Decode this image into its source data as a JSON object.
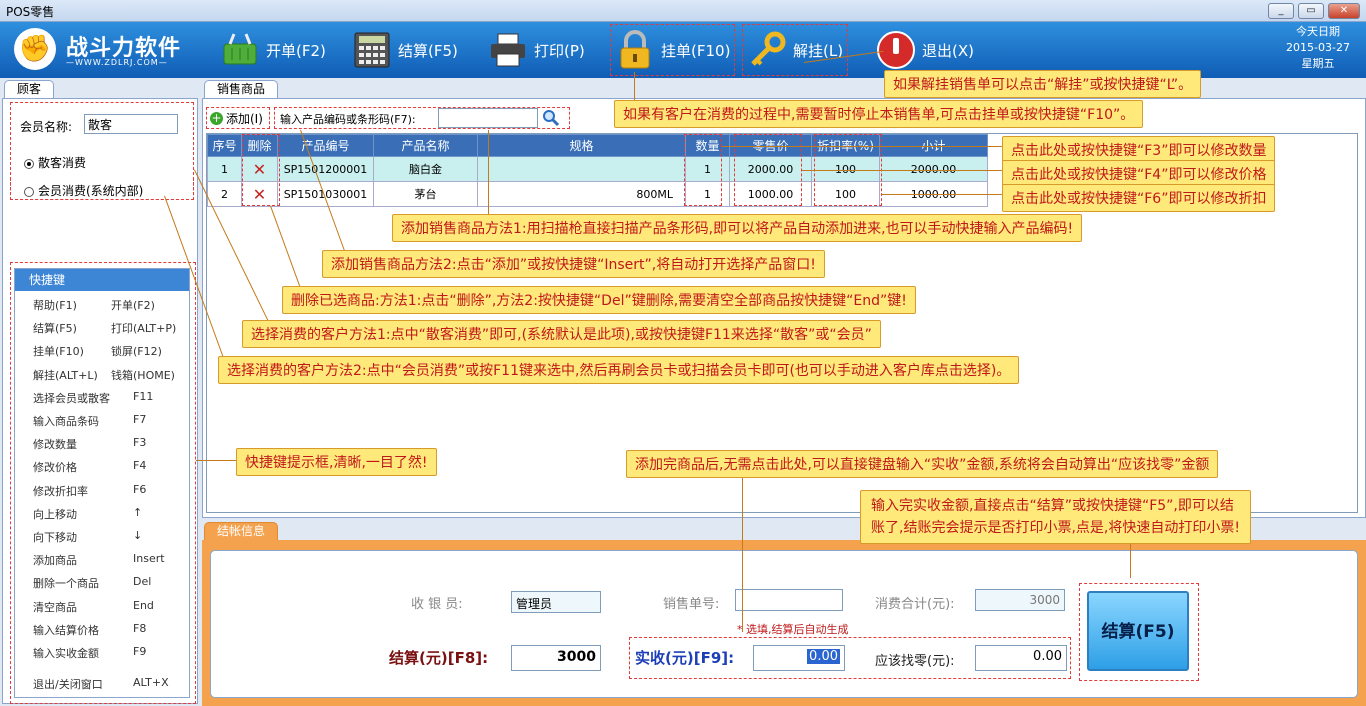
{
  "window": {
    "title": "POS零售",
    "min": "_",
    "max": "▭",
    "close": "✕"
  },
  "logo": {
    "name": "战斗力软件",
    "url": "—WWW.ZDLRJ.COM—"
  },
  "toolbar": [
    {
      "icon": "basket-icon",
      "label": "开单(F2)"
    },
    {
      "icon": "calculator-icon",
      "label": "结算(F5)"
    },
    {
      "icon": "printer-icon",
      "label": "打印(P)"
    },
    {
      "icon": "lock-icon",
      "label": "挂单(F10)"
    },
    {
      "icon": "key-icon",
      "label": "解挂(L)"
    },
    {
      "icon": "power-icon",
      "label": "退出(X)"
    }
  ],
  "date": {
    "label": "今天日期",
    "value": "2015-03-27",
    "weekday": "星期五"
  },
  "customer": {
    "tab": "顾客",
    "member_label": "会员名称:",
    "member_value": "散客",
    "radio_walkin": "散客消费",
    "radio_member": "会员消费(系统内部)"
  },
  "shortcuts": {
    "title": "快捷键",
    "items": [
      [
        "帮助(F1)",
        "开单(F2)"
      ],
      [
        "结算(F5)",
        "打印(ALT+P)"
      ],
      [
        "挂单(F10)",
        "锁屏(F12)"
      ],
      [
        "解挂(ALT+L)",
        "钱箱(HOME)"
      ],
      [
        "选择会员或散客",
        "F11"
      ],
      [
        "输入商品条码",
        "F7"
      ],
      [
        "修改数量",
        "F3"
      ],
      [
        "修改价格",
        "F4"
      ],
      [
        "修改折扣率",
        "F6"
      ],
      [
        "向上移动",
        "↑"
      ],
      [
        "向下移动",
        "↓"
      ],
      [
        "添加商品",
        "Insert"
      ],
      [
        "删除一个商品",
        "Del"
      ],
      [
        "清空商品",
        "End"
      ],
      [
        "输入结算价格",
        "F8"
      ],
      [
        "输入实收金额",
        "F9"
      ],
      [
        "退出/关闭窗口",
        "ALT+X"
      ]
    ]
  },
  "sales": {
    "tab": "销售商品",
    "add_label": "添加(I)",
    "barcode_label": "输入产品编码或条形码(F7):",
    "barcode_value": "",
    "columns": [
      "序号",
      "删除",
      "产品编号",
      "产品名称",
      "规格",
      "数量",
      "零售价",
      "折扣率(%)",
      "小计"
    ],
    "rows": [
      {
        "no": "1",
        "code": "SP1501200001",
        "name": "脑白金",
        "spec": "",
        "qty": "1",
        "price": "2000.00",
        "discount": "100",
        "subtotal": "2000.00"
      },
      {
        "no": "2",
        "code": "SP1501030001",
        "name": "茅台",
        "spec": "800ML",
        "qty": "1",
        "price": "1000.00",
        "discount": "100",
        "subtotal": "1000.00"
      }
    ]
  },
  "settle": {
    "tab": "结帐信息",
    "cashier_label": "收 银 员:",
    "cashier_value": "管理员",
    "order_label": "销售单号:",
    "order_value": "",
    "order_note": "* 选填,结算后自动生成",
    "total_label": "消费合计(元):",
    "total_value": "3000",
    "settle_label": "结算(元)[F8]:",
    "settle_value": "3000",
    "received_label": "实收(元)[F9]:",
    "received_value": "0.00",
    "change_label": "应该找零(元):",
    "change_value": "0.00",
    "button": "结算(F5)"
  },
  "callouts": {
    "c1": "如果解挂销售单可以点击“解挂”或按快捷键“L”。",
    "c2": "如果有客户在消费的过程中,需要暂时停止本销售单,可点击挂单或按快捷键“F10”。",
    "c3": "点击此处或按快捷键“F3”即可以修改数量",
    "c4": "点击此处或按快捷键“F4”即可以修改价格",
    "c5": "点击此处或按快捷键“F6”即可以修改折扣",
    "c6": "添加销售商品方法1:用扫描枪直接扫描产品条形码,即可以将产品自动添加进来,也可以手动快捷输入产品编码!",
    "c7": "添加销售商品方法2:点击“添加”或按快捷键“Insert”,将自动打开选择产品窗口!",
    "c8": "删除已选商品:方法1:点击“删除”,方法2:按快捷键“Del”键删除,需要清空全部商品按快捷键“End”键!",
    "c9": "选择消费的客户方法1:点中“散客消费”即可,(系统默认是此项),或按快捷键F11来选择“散客”或“会员”",
    "c10": "选择消费的客户方法2:点中“会员消费”或按F11键来选中,然后再刷会员卡或扫描会员卡即可(也可以手动进入客户库点击选择)。",
    "c11": "快捷键提示框,清晰,一目了然!",
    "c12": "添加完商品后,无需点击此处,可以直接键盘输入“实收”金额,系统将会自动算出“应该找零”金额",
    "c13a": "输入完实收金额,直接点击“结算”或按快捷键“F5”,即可以结",
    "c13b": "账了,结账完会提示是否打印小票,点是,将快速自动打印小票!"
  }
}
